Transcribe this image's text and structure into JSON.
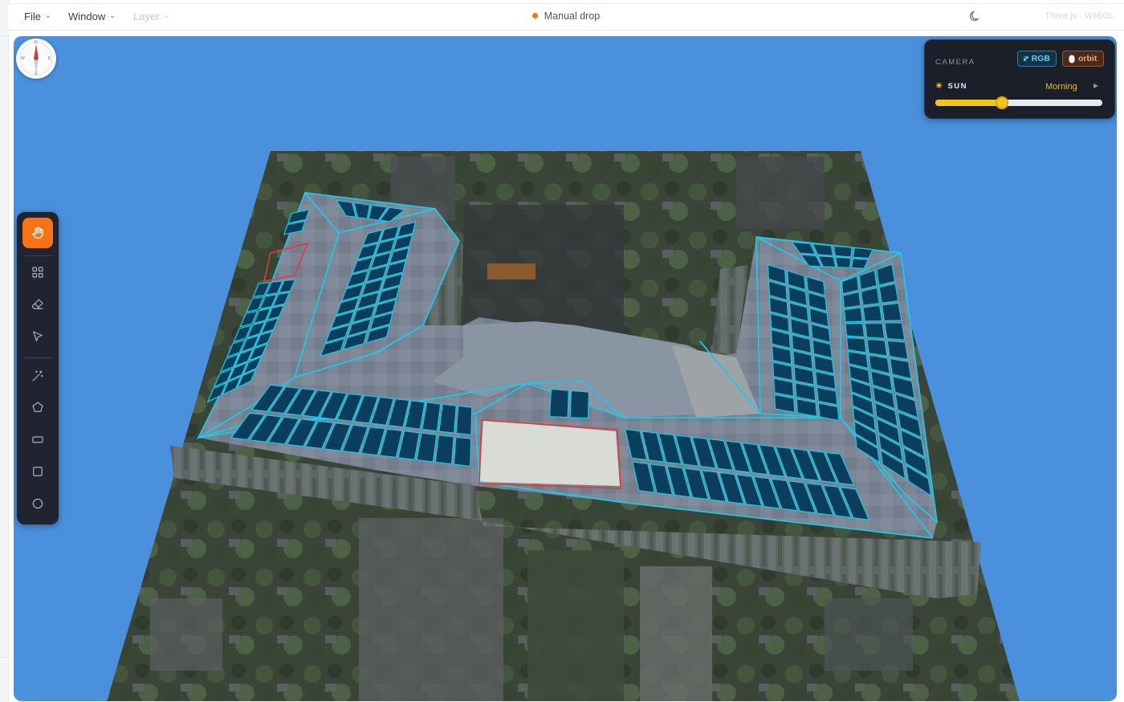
{
  "menus": [
    {
      "label": "File",
      "enabled": true
    },
    {
      "label": "Window",
      "enabled": true
    },
    {
      "label": "Layer",
      "enabled": false
    }
  ],
  "status": {
    "text": "Manual drop",
    "dot_color": "#f97316"
  },
  "engine_label": "Three.js · WebGL",
  "compass": {
    "n": "N",
    "s": "S",
    "e": "E",
    "w": "W"
  },
  "tools": [
    {
      "name": "pan-tool",
      "icon": "hand-icon",
      "active": true
    },
    {
      "name": "grid-tool",
      "icon": "grid-icon",
      "active": false
    },
    {
      "name": "eraser-tool",
      "icon": "eraser-icon",
      "active": false
    },
    {
      "name": "select-tool",
      "icon": "cursor-arrow-icon",
      "active": false
    },
    {
      "name": "magic-wand-tool",
      "icon": "magic-wand-icon",
      "active": false
    },
    {
      "name": "polygon-tool",
      "icon": "pentagon-icon",
      "active": false
    },
    {
      "name": "rectangle-tool",
      "icon": "rectangle-icon",
      "active": false
    },
    {
      "name": "square-tool",
      "icon": "square-icon",
      "active": false
    },
    {
      "name": "circle-tool",
      "icon": "circle-icon",
      "active": false
    }
  ],
  "camera": {
    "label": "CAMERA",
    "rgb_label": "RGB",
    "orbit_label": "orbit",
    "sun_label": "SUN",
    "sun_value": "Morning",
    "sun_level": 0.4
  },
  "colors": {
    "accent": "#f97316",
    "viewport_bg": "#4a90dc",
    "panel_outline": "#1ec8e6",
    "panel_fill": "#0b3d5c",
    "exclusion": "#e53935",
    "sun": "#f5c518"
  }
}
